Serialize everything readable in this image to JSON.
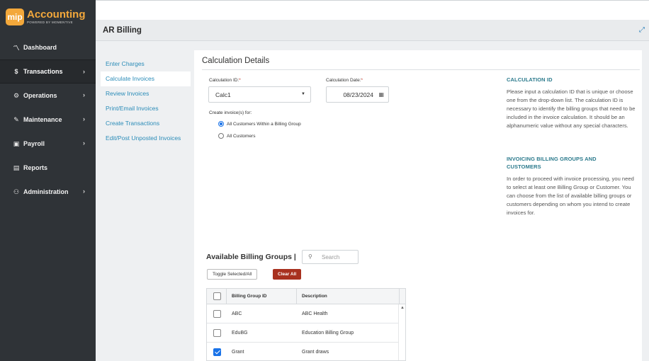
{
  "logo": {
    "badge": "mip",
    "name": "Accounting",
    "subtitle": "POWERED BY MOMENTIVE"
  },
  "sidebar": {
    "items": [
      {
        "label": "Dashboard",
        "icon": "chart-line-icon",
        "glyph": "📈"
      },
      {
        "label": "Transactions",
        "icon": "dollar-icon",
        "glyph": "$"
      },
      {
        "label": "Operations",
        "icon": "gears-icon",
        "glyph": "⚙"
      },
      {
        "label": "Maintenance",
        "icon": "wrench-icon",
        "glyph": "🔧"
      },
      {
        "label": "Payroll",
        "icon": "money-bill-icon",
        "glyph": "▣"
      },
      {
        "label": "Reports",
        "icon": "document-icon",
        "glyph": "🗎"
      },
      {
        "label": "Administration",
        "icon": "users-cog-icon",
        "glyph": "👥"
      }
    ],
    "chevron": "›"
  },
  "header": {
    "title": "AR Billing",
    "expand_glyph": "⤢"
  },
  "subnav": {
    "items": [
      "Enter Charges",
      "Calculate Invoices",
      "Review Invoices",
      "Print/Email Invoices",
      "Create Transactions",
      "Edit/Post Unposted Invoices"
    ]
  },
  "panel": {
    "title": "Calculation Details",
    "calc_id_label": "Calculation ID:",
    "calc_id_value": "Calc1",
    "calc_date_label": "Calculation Date:",
    "calc_date_value": "08/23/2024",
    "required_mark": "*",
    "create_for_label": "Create invoice(s) for:",
    "radio_options": [
      "All Customers Within a Billing Group",
      "All Customers"
    ],
    "selected_radio": 0
  },
  "help": {
    "h1": "CALCULATION ID",
    "p1": "Please input a calculation ID that is unique or choose one from the drop-down list. The calculation ID is necessary to identify the billing groups that need to be included in the invoice calculation. It should be an alphanumeric value without any special characters.",
    "h2": "INVOICING BILLING GROUPS AND CUSTOMERS",
    "p2": "In order to proceed with invoice processing, you need to select at least one Billing Group or Customer. You can choose from the list of available billing groups or customers depending on whom you intend to create invoices for."
  },
  "billing_groups": {
    "title": "Available Billing Groups |",
    "search_placeholder": "Search",
    "toggle_label": "Toggle Selected/All",
    "clear_label": "Clear All",
    "columns": [
      "Billing Group ID",
      "Description"
    ],
    "rows": [
      {
        "id": "ABC",
        "description": "ABC Health",
        "checked": false
      },
      {
        "id": "EduBG",
        "description": "Education Billing Group",
        "checked": false
      },
      {
        "id": "Grant",
        "description": "Grant draws",
        "checked": true
      }
    ]
  },
  "colors": {
    "sidebar": "#2f3337",
    "accent": "#2b8cb8",
    "brand": "#f3a83b",
    "danger": "#a8311f",
    "check": "#1a73e8"
  }
}
